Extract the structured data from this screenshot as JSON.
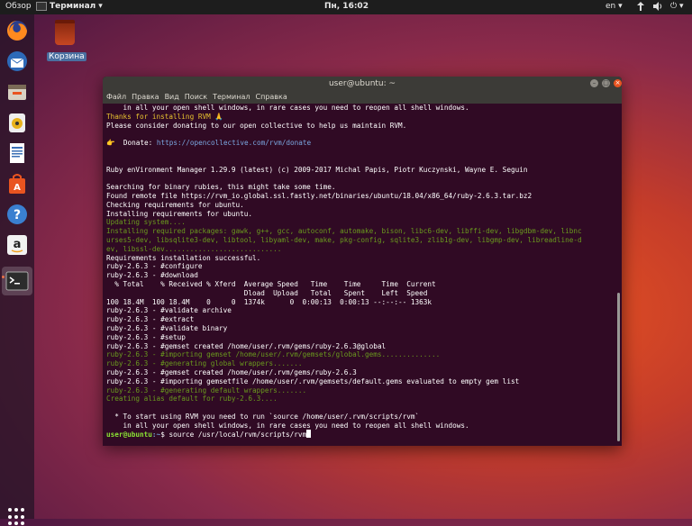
{
  "topbar": {
    "activities": "Обзор",
    "app_name": "Терминал",
    "clock": "Пн, 16:02",
    "lang": "en"
  },
  "desktop": {
    "trash_label": "Корзина"
  },
  "terminal": {
    "title": "user@ubuntu: ~",
    "menu": [
      "Файл",
      "Правка",
      "Вид",
      "Поиск",
      "Терминал",
      "Справка"
    ],
    "lines": [
      {
        "t": "    in all your open shell windows, in rare cases you need to reopen all shell windows.",
        "c": ""
      },
      {
        "t": "Thanks for installing RVM 🙏",
        "c": "c-yellow"
      },
      {
        "t": "Please consider donating to our open collective to help us maintain RVM.",
        "c": ""
      },
      {
        "t": "",
        "c": ""
      },
      {
        "t": "👉  Donate: ",
        "c": "",
        "link": "https://opencollective.com/rvm/donate"
      },
      {
        "t": "",
        "c": ""
      },
      {
        "t": "",
        "c": ""
      },
      {
        "t": "Ruby enVironment Manager 1.29.9 (latest) (c) 2009-2017 Michal Papis, Piotr Kuczynski, Wayne E. Seguin",
        "c": ""
      },
      {
        "t": "",
        "c": ""
      },
      {
        "t": "Searching for binary rubies, this might take some time.",
        "c": ""
      },
      {
        "t": "Found remote file https://rvm_io.global.ssl.fastly.net/binaries/ubuntu/18.04/x86_64/ruby-2.6.3.tar.bz2",
        "c": ""
      },
      {
        "t": "Checking requirements for ubuntu.",
        "c": ""
      },
      {
        "t": "Installing requirements for ubuntu.",
        "c": ""
      },
      {
        "t": "Updating system....",
        "c": "c-green"
      },
      {
        "t": "Installing required packages: gawk, g++, gcc, autoconf, automake, bison, libc6-dev, libffi-dev, libgdbm-dev, libnc",
        "c": "c-green"
      },
      {
        "t": "urses5-dev, libsqlite3-dev, libtool, libyaml-dev, make, pkg-config, sqlite3, zlib1g-dev, libgmp-dev, libreadline-d",
        "c": "c-green"
      },
      {
        "t": "ev, libssl-dev............................",
        "c": "c-green"
      },
      {
        "t": "Requirements installation successful.",
        "c": ""
      },
      {
        "t": "ruby-2.6.3 - #configure",
        "c": ""
      },
      {
        "t": "ruby-2.6.3 - #download",
        "c": ""
      },
      {
        "t": "  % Total    % Received % Xferd  Average Speed   Time    Time     Time  Current",
        "c": ""
      },
      {
        "t": "                                 Dload  Upload   Total   Spent    Left  Speed",
        "c": ""
      },
      {
        "t": "100 18.4M  100 18.4M    0     0  1374k      0  0:00:13  0:00:13 --:--:-- 1363k",
        "c": ""
      },
      {
        "t": "ruby-2.6.3 - #validate archive",
        "c": ""
      },
      {
        "t": "ruby-2.6.3 - #extract",
        "c": ""
      },
      {
        "t": "ruby-2.6.3 - #validate binary",
        "c": ""
      },
      {
        "t": "ruby-2.6.3 - #setup",
        "c": ""
      },
      {
        "t": "ruby-2.6.3 - #gemset created /home/user/.rvm/gems/ruby-2.6.3@global",
        "c": ""
      },
      {
        "t": "ruby-2.6.3 - #importing gemset /home/user/.rvm/gemsets/global.gems..............",
        "c": "c-green"
      },
      {
        "t": "ruby-2.6.3 - #generating global wrappers.......",
        "c": "c-green"
      },
      {
        "t": "ruby-2.6.3 - #gemset created /home/user/.rvm/gems/ruby-2.6.3",
        "c": ""
      },
      {
        "t": "ruby-2.6.3 - #importing gemsetfile /home/user/.rvm/gemsets/default.gems evaluated to empty gem list",
        "c": ""
      },
      {
        "t": "ruby-2.6.3 - #generating default wrappers.......",
        "c": "c-green"
      },
      {
        "t": "Creating alias default for ruby-2.6.3....",
        "c": "c-green"
      },
      {
        "t": "",
        "c": ""
      },
      {
        "t": "  * To start using RVM you need to run `source /home/user/.rvm/scripts/rvm`",
        "c": ""
      },
      {
        "t": "    in all your open shell windows, in rare cases you need to reopen all shell windows.",
        "c": ""
      }
    ],
    "prompt_user": "user@ubuntu",
    "prompt_path": ":~",
    "prompt_cmd": "$ source /usr/local/rvm/scripts/rvm"
  }
}
